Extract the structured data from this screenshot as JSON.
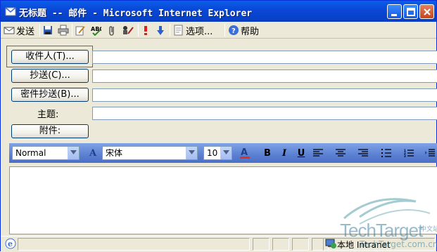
{
  "window": {
    "title": "无标题 -- 邮件 - Microsoft Internet Explorer"
  },
  "toolbar": {
    "send_label": "发送",
    "options_label": "选项...",
    "help_label": "帮助"
  },
  "address": {
    "to_label": "收件人(T)...",
    "cc_label": "抄送(C)...",
    "bcc_label": "密件抄送(B)...",
    "subject_label": "主题:",
    "attach_label": "附件:",
    "to_value": "",
    "cc_value": "",
    "bcc_value": "",
    "subject_value": ""
  },
  "format": {
    "style": "Normal",
    "font": "宋体",
    "size": "10",
    "bold": "B",
    "italic": "I",
    "underline": "U"
  },
  "status": {
    "zone": "本地 Intranet"
  },
  "watermark": {
    "brand": "TechTarget",
    "suffix": "中文站",
    "url": "TechTarget.com.cn"
  },
  "colors": {
    "titlebar": "#0a48d8",
    "formatbar": "#5b80d2",
    "highlight_border": "#d23a3a"
  },
  "icons": [
    "ie-icon",
    "minimize-icon",
    "maximize-icon",
    "close-icon",
    "send-icon",
    "save-icon",
    "print-icon",
    "edit-icon",
    "spellcheck-icon",
    "attach-icon",
    "signature-icon",
    "high-priority-icon",
    "low-priority-icon",
    "options-icon",
    "help-icon",
    "font-color-icon",
    "align-left-icon",
    "align-center-icon",
    "align-right-icon",
    "bullets-icon",
    "numbering-icon",
    "indent-icon",
    "globe-zone-icon"
  ]
}
